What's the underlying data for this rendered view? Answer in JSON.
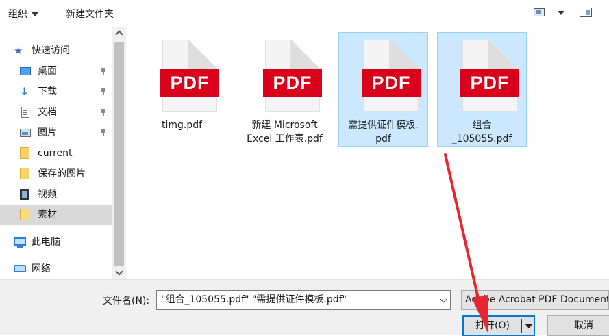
{
  "toolbar": {
    "organize_label": "组织",
    "new_folder_label": "新建文件夹"
  },
  "nav": {
    "quick_access_label": "快速访问",
    "items": [
      {
        "label": "桌面"
      },
      {
        "label": "下载"
      },
      {
        "label": "文档"
      },
      {
        "label": "图片"
      },
      {
        "label": "current"
      },
      {
        "label": "保存的图片"
      },
      {
        "label": "视频"
      },
      {
        "label": "素材"
      }
    ],
    "this_pc_label": "此电脑",
    "network_label": "网络"
  },
  "files": [
    {
      "name": "timg.pdf",
      "icon_text": "PDF",
      "selected": false
    },
    {
      "name": "新建 Microsoft\nExcel 工作表.pdf",
      "icon_text": "PDF",
      "selected": false
    },
    {
      "name": "需提供证件模板.\npdf",
      "icon_text": "PDF",
      "selected": true
    },
    {
      "name": "组合\n_105055.pdf",
      "icon_text": "PDF",
      "selected": true
    }
  ],
  "bottom": {
    "filename_label": "文件名(N):",
    "filename_value": "\"组合_105055.pdf\" \"需提供证件模板.pdf\"",
    "filetype_value": "Adobe Acrobat PDF Document",
    "open_label": "打开(O)",
    "cancel_label": "取消"
  },
  "colors": {
    "selection_bg": "#cce8ff",
    "selection_border": "#99d1ff",
    "pdf_red": "#d9001b",
    "accent": "#0078d7",
    "annotation_arrow": "#e8262d"
  }
}
